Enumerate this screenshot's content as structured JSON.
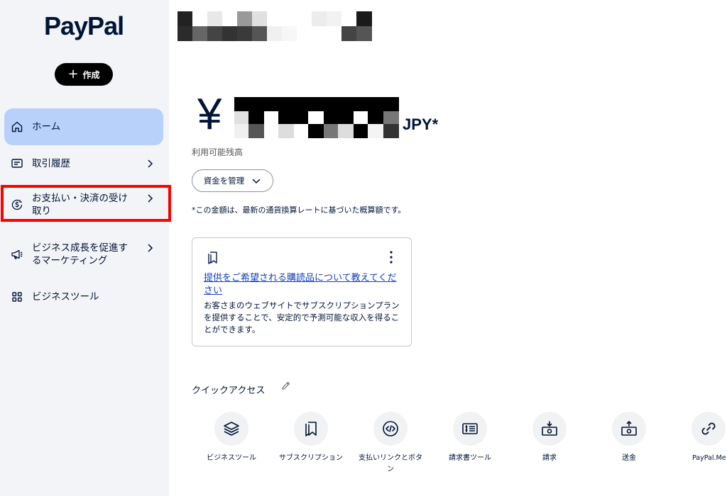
{
  "sidebar": {
    "logo": "PayPal",
    "create_label": "作成",
    "items": [
      {
        "label": "ホーム"
      },
      {
        "label": "取引履歴"
      },
      {
        "label": "お支払い・決済の受け取り"
      },
      {
        "label": "ビジネス成長を促進するマーケティング"
      },
      {
        "label": "ビジネスツール"
      }
    ]
  },
  "balance": {
    "symbol": "¥",
    "currency": "JPY*",
    "label": "利用可能残高",
    "manage_label": "資金を管理",
    "note": "*この金額は、最新の通貨換算レートに基づいた概算額です。"
  },
  "card": {
    "link": "提供をご希望される購読品について教えてください",
    "description": "お客さまのウェブサイトでサブスクリプションプランを提供することで、安定的で予測可能な収入を得ることができます。"
  },
  "quick_access": {
    "title": "クイックアクセス",
    "items": [
      {
        "label": "ビジネスツール",
        "icon": "layers-icon"
      },
      {
        "label": "サブスクリプション",
        "icon": "bookmarks-icon"
      },
      {
        "label": "支払いリンクとボタン",
        "icon": "code-icon"
      },
      {
        "label": "請求書ツール",
        "icon": "invoice-icon"
      },
      {
        "label": "請求",
        "icon": "request-money-icon"
      },
      {
        "label": "送金",
        "icon": "send-money-icon"
      },
      {
        "label": "PayPal.Me",
        "icon": "link-icon"
      }
    ]
  },
  "colors": {
    "sidebar_bg": "#f3f4f7",
    "active_bg": "#b8d1fb",
    "text": "#001435",
    "link": "#1040c1",
    "highlight": "#ff0000"
  }
}
